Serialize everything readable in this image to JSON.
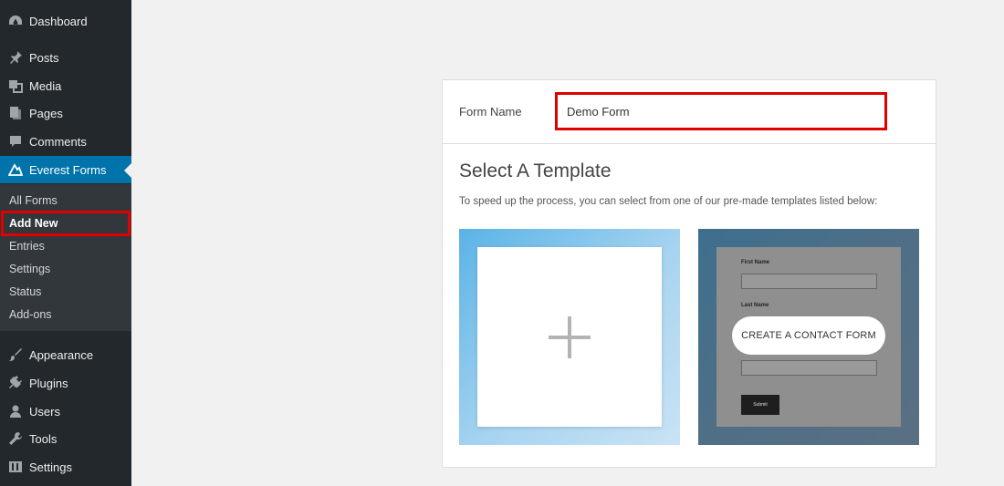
{
  "sidebar": {
    "items": [
      {
        "label": "Dashboard",
        "icon": "dashboard-icon"
      },
      {
        "label": "Posts",
        "icon": "pin-icon"
      },
      {
        "label": "Media",
        "icon": "media-icon"
      },
      {
        "label": "Pages",
        "icon": "pages-icon"
      },
      {
        "label": "Comments",
        "icon": "comment-icon"
      },
      {
        "label": "Everest Forms",
        "icon": "everest-forms-icon",
        "active": true
      },
      {
        "label": "Appearance",
        "icon": "brush-icon"
      },
      {
        "label": "Plugins",
        "icon": "plugin-icon"
      },
      {
        "label": "Users",
        "icon": "user-icon"
      },
      {
        "label": "Tools",
        "icon": "wrench-icon"
      },
      {
        "label": "Settings",
        "icon": "settings-icon"
      }
    ],
    "submenu": [
      "All Forms",
      "Add New",
      "Entries",
      "Settings",
      "Status",
      "Add-ons"
    ],
    "current_submenu": "Add New"
  },
  "form": {
    "name_label": "Form Name",
    "name_value": "Demo Form"
  },
  "templates": {
    "title": "Select A Template",
    "description": "To speed up the process, you can select from one of our pre-made templates listed below:",
    "contact_preview": {
      "first_name_label": "First Name",
      "last_name_label": "Last Name",
      "submit_label": "Submit"
    },
    "create_button": "CREATE A CONTACT FORM"
  },
  "colors": {
    "sidebar_bg": "#23282d",
    "active_bg": "#0073aa",
    "highlight": "#e00000"
  }
}
